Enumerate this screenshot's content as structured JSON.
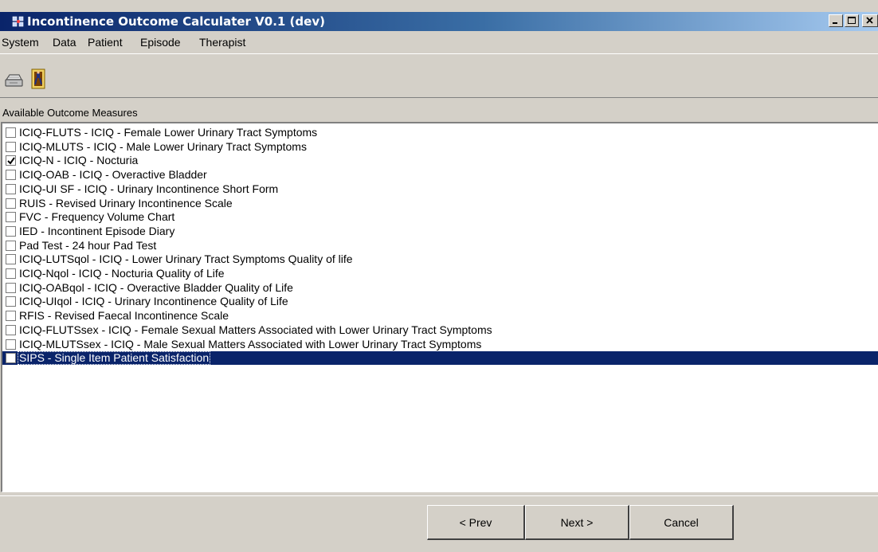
{
  "window": {
    "title": "Incontinence Outcome Calculater V0.1 (dev)"
  },
  "menu": [
    "System",
    "Data",
    "Patient",
    "Episode",
    "Therapist"
  ],
  "toolbar": {
    "buttons": [
      {
        "icon": "printer-icon"
      },
      {
        "icon": "exit-door-icon"
      }
    ]
  },
  "measures": {
    "label": "Available Outcome Measures",
    "items": [
      {
        "label": "ICIQ-FLUTS - ICIQ - Female Lower Urinary Tract Symptoms",
        "checked": false
      },
      {
        "label": "ICIQ-MLUTS - ICIQ - Male Lower Urinary Tract Symptoms",
        "checked": false
      },
      {
        "label": "ICIQ-N - ICIQ - Nocturia",
        "checked": true
      },
      {
        "label": "ICIQ-OAB - ICIQ - Overactive Bladder",
        "checked": false
      },
      {
        "label": "ICIQ-UI SF - ICIQ - Urinary Incontinence Short Form",
        "checked": false
      },
      {
        "label": "RUIS - Revised Urinary Incontinence Scale",
        "checked": false
      },
      {
        "label": "FVC - Frequency Volume Chart",
        "checked": false
      },
      {
        "label": "IED - Incontinent Episode Diary",
        "checked": false
      },
      {
        "label": "Pad Test - 24 hour Pad Test",
        "checked": false
      },
      {
        "label": "ICIQ-LUTSqol - ICIQ - Lower Urinary Tract Symptoms Quality of life",
        "checked": false
      },
      {
        "label": "ICIQ-Nqol - ICIQ - Nocturia Quality of Life",
        "checked": false
      },
      {
        "label": "ICIQ-OABqol - ICIQ - Overactive Bladder Quality of Life",
        "checked": false
      },
      {
        "label": "ICIQ-UIqol - ICIQ - Urinary Incontinence Quality of Life",
        "checked": false
      },
      {
        "label": "RFIS - Revised Faecal Incontinence Scale",
        "checked": false
      },
      {
        "label": "ICIQ-FLUTSsex - ICIQ - Female Sexual Matters Associated with Lower Urinary Tract Symptoms",
        "checked": false
      },
      {
        "label": "ICIQ-MLUTSsex - ICIQ - Male Sexual Matters Associated with Lower Urinary Tract Symptoms",
        "checked": false
      },
      {
        "label": "SIPS - Single Item Patient Satisfaction",
        "checked": false,
        "selected": true
      }
    ]
  },
  "footer": {
    "prev_label": "< Prev",
    "next_label": "Next >",
    "cancel_label": "Cancel"
  },
  "colors": {
    "titlebar_start": "#0a246a",
    "titlebar_end": "#a6caf0",
    "selection": "#0a246a",
    "face": "#d4d0c8"
  }
}
